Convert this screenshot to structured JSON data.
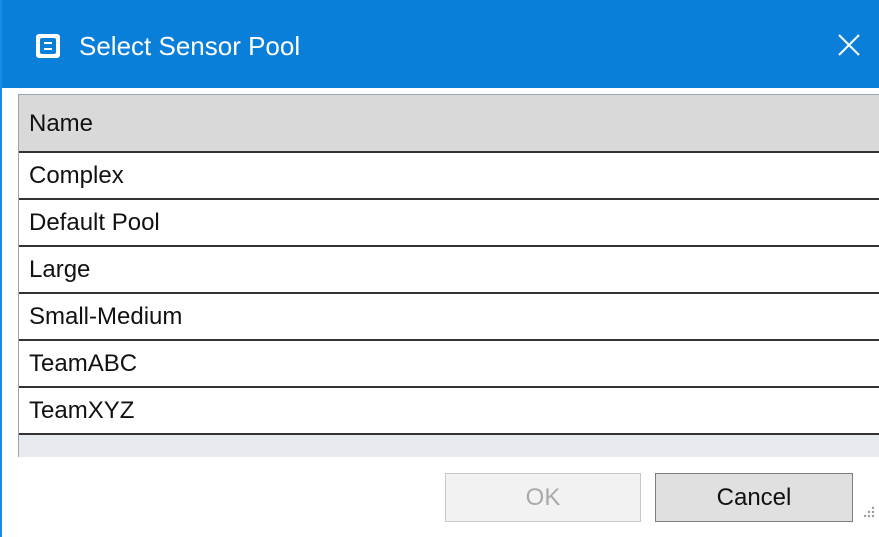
{
  "window": {
    "title": "Select Sensor Pool",
    "icon": "app-icon",
    "close_icon": "close-icon"
  },
  "grid": {
    "columns": [
      "Name"
    ],
    "rows": [
      {
        "name": "Complex"
      },
      {
        "name": "Default Pool"
      },
      {
        "name": "Large"
      },
      {
        "name": "Small-Medium"
      },
      {
        "name": "TeamABC"
      },
      {
        "name": "TeamXYZ"
      }
    ]
  },
  "buttons": {
    "ok_label": "OK",
    "ok_enabled": false,
    "cancel_label": "Cancel"
  },
  "colors": {
    "titlebar": "#0a7fd9",
    "header": "#d9d9d9",
    "grid_bg": "#e7ebf0"
  }
}
